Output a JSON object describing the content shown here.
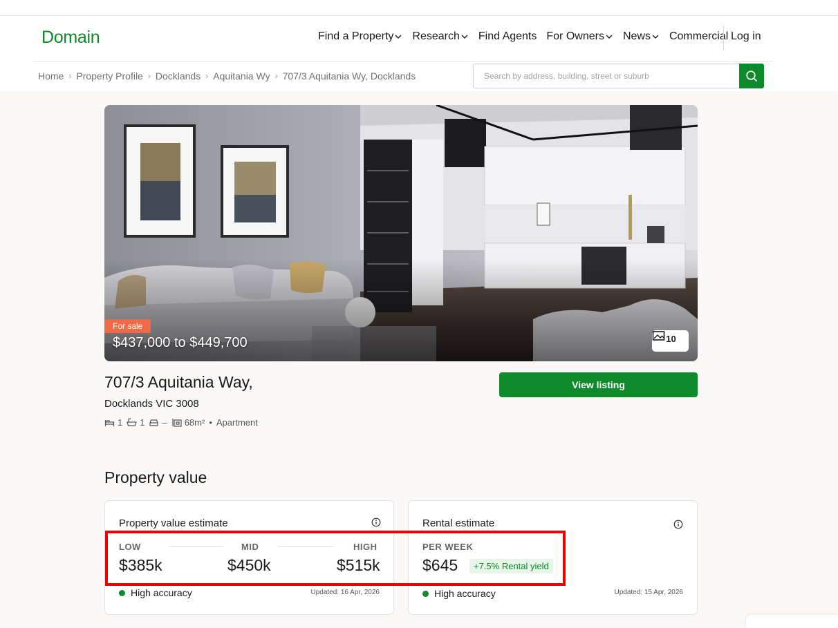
{
  "header": {
    "logo": "Domain",
    "nav": [
      {
        "label": "Find a Property",
        "has_dropdown": true
      },
      {
        "label": "Research",
        "has_dropdown": true
      },
      {
        "label": "Find Agents",
        "has_dropdown": false
      },
      {
        "label": "For Owners",
        "has_dropdown": true
      },
      {
        "label": "News",
        "has_dropdown": true
      },
      {
        "label": "Commercial",
        "has_dropdown": false
      }
    ],
    "login": "Log in"
  },
  "breadcrumb": [
    "Home",
    "Property Profile",
    "Docklands",
    "Aquitania Wy",
    "707/3 Aquitania Wy, Docklands"
  ],
  "search": {
    "placeholder": "Search by address, building, street or suburb"
  },
  "listing": {
    "status": "For sale",
    "price_range": "$437,000 to $449,700",
    "photo_count": "10",
    "address_line1": "707/3 Aquitania Way,",
    "address_line2": "Docklands VIC 3008",
    "beds": "1",
    "baths": "1",
    "parking": "–",
    "land_size": "68m²",
    "type": "Apartment",
    "view_button": "View listing"
  },
  "property_value": {
    "section_title": "Property value",
    "estimate_card": {
      "title": "Property value estimate",
      "low_label": "LOW",
      "low": "$385k",
      "mid_label": "MID",
      "mid": "$450k",
      "high_label": "HIGH",
      "high": "$515k",
      "accuracy": "High accuracy",
      "updated": "Updated: 16 Apr, 2026"
    },
    "rental_card": {
      "title": "Rental estimate",
      "per_week_label": "PER WEEK",
      "per_week": "$645",
      "yield": "+7.5% Rental yield",
      "accuracy": "High accuracy",
      "updated": "Updated: 15 Apr, 2026"
    }
  },
  "colors": {
    "brand_green": "#0d8a29",
    "sale_tag": "#ef6a45",
    "highlight": "#f00000"
  }
}
